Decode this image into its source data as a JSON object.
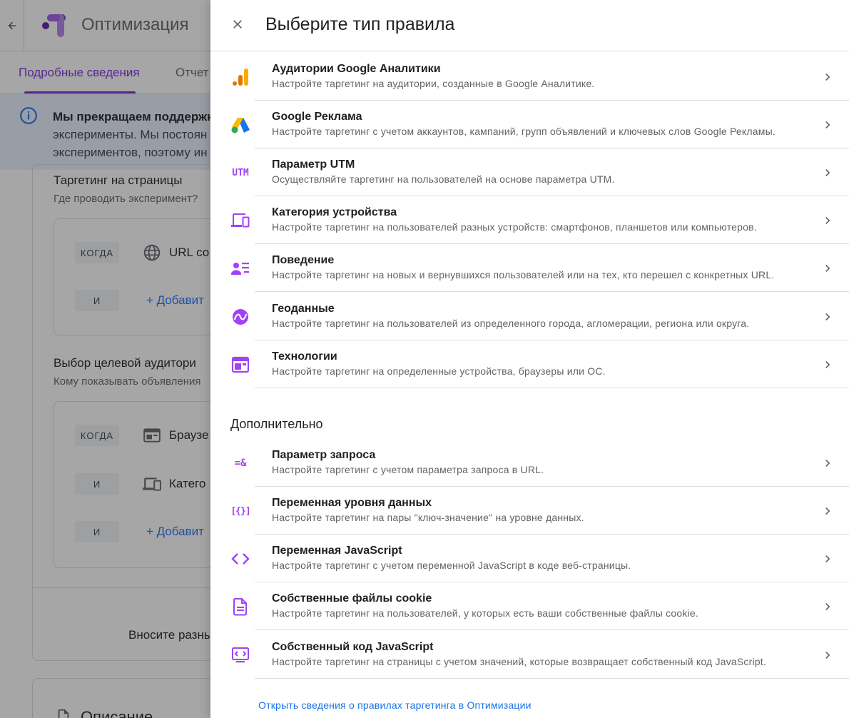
{
  "app": {
    "title": "Оптимизация"
  },
  "tabs": [
    {
      "label": "Подробные сведения"
    },
    {
      "label": "Отчет"
    }
  ],
  "banner": {
    "bold_text": "Мы прекращаем поддержк",
    "line2": "эксперименты. Мы постоян",
    "line3": "экспериментов, поэтому ин"
  },
  "page_targeting": {
    "title": "Таргетинг на страницы",
    "subtitle": "Где проводить эксперимент?",
    "rows": [
      {
        "chip": "КОГДА",
        "text": "URL со"
      },
      {
        "chip": "И",
        "add": "+ Добавит"
      }
    ]
  },
  "audience": {
    "title": "Выбор целевой аудитори",
    "subtitle": "Кому показывать объявления",
    "rows": [
      {
        "chip": "КОГДА",
        "text": "Браузе"
      },
      {
        "chip": "И",
        "text": "Катего"
      },
      {
        "chip": "И",
        "add": "+ Добавит"
      }
    ]
  },
  "promo_text": "Вносите разны",
  "description_title": "Описание",
  "drawer": {
    "title": "Выберите тип правила",
    "rules": [
      {
        "title": "Аудитории Google Аналитики",
        "desc": "Настройте таргетинг на аудитории, созданные в Google Аналитике.",
        "icon": "analytics-icon"
      },
      {
        "title": "Google Реклама",
        "desc": "Настройте таргетинг с учетом аккаунтов, кампаний, групп объявлений и ключевых слов Google Рекламы.",
        "icon": "google-ads-icon"
      },
      {
        "title": "Параметр UTM",
        "desc": "Осуществляйте таргетинг на пользователей на основе параметра UTM.",
        "icon": "utm-icon",
        "icon_text": "UTM"
      },
      {
        "title": "Категория устройства",
        "desc": "Настройте таргетинг на пользователей разных устройств: смартфонов, планшетов или компьютеров.",
        "icon": "devices-icon"
      },
      {
        "title": "Поведение",
        "desc": "Настройте таргетинг на новых и вернувшихся пользователей или на тех, кто перешел с конкретных URL.",
        "icon": "behavior-icon"
      },
      {
        "title": "Геоданные",
        "desc": "Настройте таргетинг на пользователей из определенного города, агломерации, региона или округа.",
        "icon": "geo-icon"
      },
      {
        "title": "Технологии",
        "desc": "Настройте таргетинг на определенные устройства, браузеры или ОС.",
        "icon": "technology-icon"
      }
    ],
    "extra_heading": "Дополнительно",
    "extra_rules": [
      {
        "title": "Параметр запроса",
        "desc": "Настройте таргетинг с учетом параметра запроса в URL.",
        "icon": "query-param-icon",
        "icon_text": "=&"
      },
      {
        "title": "Переменная уровня данных",
        "desc": "Настройте таргетинг на пары \"ключ-значение\" на уровне данных.",
        "icon": "data-layer-icon",
        "icon_text": "[{}]"
      },
      {
        "title": "Переменная JavaScript",
        "desc": "Настройте таргетинг с учетом переменной JavaScript в коде веб-страницы.",
        "icon": "code-icon"
      },
      {
        "title": "Собственные файлы cookie",
        "desc": "Настройте таргетинг на пользователей, у которых есть ваши собственные файлы cookie.",
        "icon": "cookie-file-icon"
      },
      {
        "title": "Собственный код JavaScript",
        "desc": "Настройте таргетинг на страницы с учетом значений, которые возвращает собственный код JavaScript.",
        "icon": "custom-js-icon"
      }
    ],
    "footer_link": "Открыть сведения о правилах таргетинга в Оптимизации"
  },
  "colors": {
    "accent": "#7b2bd8",
    "icon_purple": "#a142f4",
    "link": "#1a73e8",
    "banner_bg": "#e8f0fe"
  }
}
